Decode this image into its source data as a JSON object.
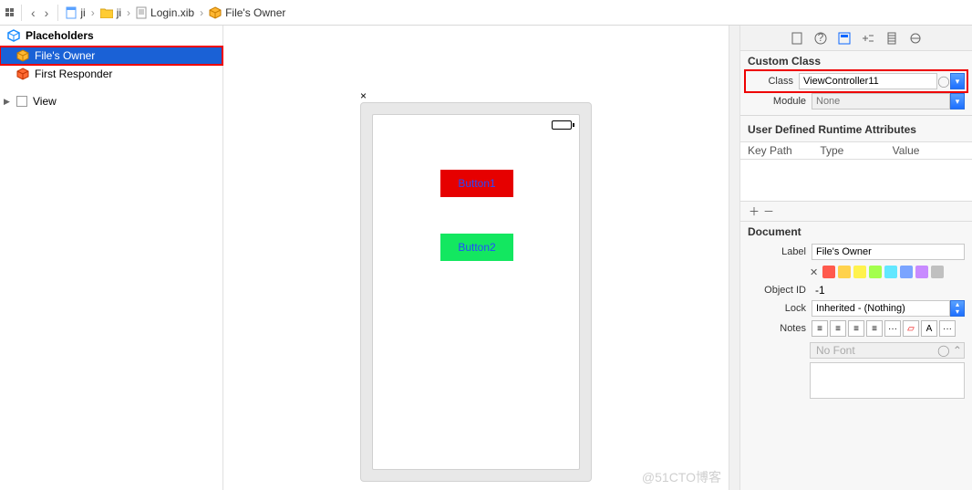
{
  "breadcrumb": {
    "items": [
      {
        "icon": "doc-blue",
        "label": "ji"
      },
      {
        "icon": "folder-yellow",
        "label": "ji"
      },
      {
        "icon": "doc-gray",
        "label": "Login.xib"
      },
      {
        "icon": "cube-gold",
        "label": "File's Owner"
      }
    ]
  },
  "outline": {
    "section_placeholders": "Placeholders",
    "files_owner": "File's Owner",
    "first_responder": "First Responder",
    "view": "View"
  },
  "canvas": {
    "button1": "Button1",
    "button2": "Button2"
  },
  "inspector": {
    "custom_class_title": "Custom Class",
    "class_label": "Class",
    "class_value": "ViewController11",
    "module_label": "Module",
    "module_placeholder": "None",
    "udra_title": "User Defined Runtime Attributes",
    "udra_cols": {
      "keypath": "Key Path",
      "type": "Type",
      "value": "Value"
    },
    "doc_title": "Document",
    "label_label": "Label",
    "label_value": "File's Owner",
    "objectid_label": "Object ID",
    "objectid_value": "-1",
    "lock_label": "Lock",
    "lock_value": "Inherited - (Nothing)",
    "notes_label": "Notes",
    "font_placeholder": "No Font",
    "swatch_colors": [
      "#ff5a4d",
      "#ffd24d",
      "#fff24d",
      "#a3ff4d",
      "#62e7ff",
      "#7aa4ff",
      "#c88aff",
      "#c0c0c0"
    ]
  },
  "watermark": "@51CTO博客"
}
